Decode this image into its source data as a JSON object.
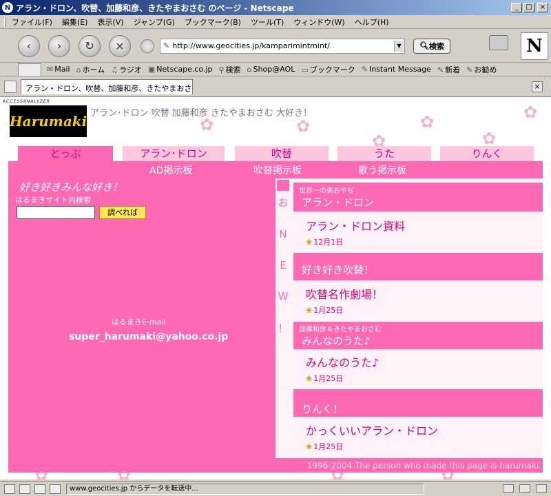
{
  "window": {
    "title": "アラン・ドロン、吹替、加藤和彦、きたやまおさむ のページ - Netscape",
    "controls": [
      "_",
      "□",
      "×"
    ]
  },
  "menu": [
    "ファイル(F)",
    "編集(E)",
    "表示(V)",
    "ジャンプ(G)",
    "ブックマーク(B)",
    "ツール(T)",
    "ウィンドウ(W)",
    "ヘルプ(H)"
  ],
  "nav": {
    "url": "http://www.geocities.jp/kamparimintmint/",
    "search_label": "検索",
    "throbber": "N"
  },
  "personal_toolbar": [
    "Mail",
    "ホーム",
    "ラジオ",
    "Netscape.co.jp",
    "検索",
    "Shop@AOL",
    "ブックマーク",
    "Instant Message",
    "新着",
    "お勧め"
  ],
  "tab": {
    "label": "アラン・ドロン、吹替、加藤和彦、きたやまおさ...",
    "close": "×"
  },
  "page": {
    "analyzer": "ACCESSANALYZER",
    "logo": "Harumaki",
    "tagline": "アラン･ドロン 吹替 加藤和彦 きたやまおさむ 大好き！",
    "tabs": [
      "とっぷ",
      "アラン･ドロン",
      "吹替",
      "うた",
      "りんく"
    ],
    "sublinks": [
      "AD掲示板",
      "吹替掲示板",
      "歌う掲示板"
    ],
    "left": {
      "heading": "好き好きみんな好き！",
      "search_label": "はるまきサイト内検索",
      "search_button": "調べれば",
      "mail_label": "はるまきE-mail",
      "mail_address": "super_harumaki@yahoo.co.jp"
    },
    "news_side": [
      "お",
      "N",
      "E",
      "W",
      "！"
    ],
    "news": [
      {
        "small": "世界一の美おやぢ",
        "heading": "アラン・ドロン",
        "link": "アラン・ドロン資料",
        "date": "12月1日"
      },
      {
        "small": "",
        "heading": "好き好き吹替！",
        "link": "吹替名作劇場！",
        "date": "1月25日"
      },
      {
        "small": "加藤和彦＆きたやまおさむ",
        "heading": "みんなのうた♪",
        "link": "みんなのうた♪",
        "date": "1月25日"
      },
      {
        "small": "",
        "heading": "りんく！",
        "link": "かっくいいアラン・ドロン",
        "date": "1月25日"
      }
    ],
    "footer": "1996-2004 The person who made this page is harumaki."
  },
  "status": {
    "text": "www.geocities.jp からデータを転送中..."
  }
}
